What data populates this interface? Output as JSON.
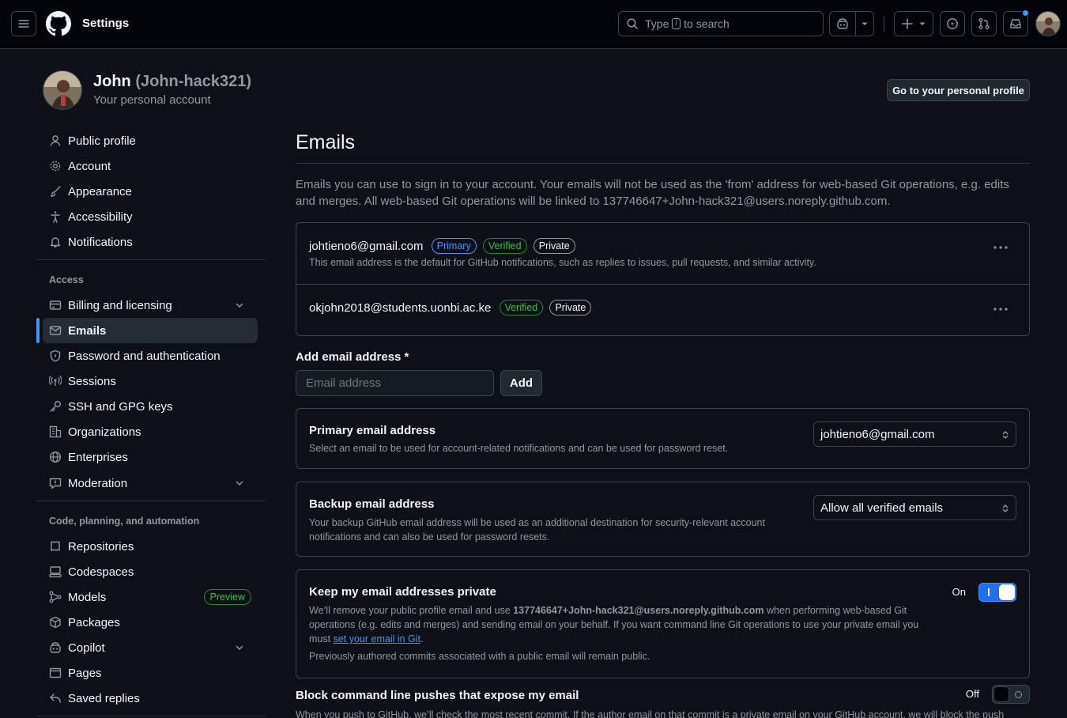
{
  "header": {
    "title": "Settings",
    "search_prefix": "Type",
    "search_key": "/",
    "search_suffix": "to search"
  },
  "profile": {
    "name": "John",
    "handle": "(John-hack321)",
    "subtitle": "Your personal account",
    "go_profile_label": "Go to your personal profile"
  },
  "sidebar": {
    "items_top": [
      "Public profile",
      "Account",
      "Appearance",
      "Accessibility",
      "Notifications"
    ],
    "access_title": "Access",
    "access_items": [
      "Billing and licensing",
      "Emails",
      "Password and authentication",
      "Sessions",
      "SSH and GPG keys",
      "Organizations",
      "Enterprises",
      "Moderation"
    ],
    "code_title": "Code, planning, and automation",
    "code_items": [
      "Repositories",
      "Codespaces",
      "Models",
      "Packages",
      "Copilot",
      "Pages",
      "Saved replies"
    ],
    "preview_badge": "Preview"
  },
  "main": {
    "title": "Emails",
    "intro": "Emails you can use to sign in to your account. Your emails will not be used as the 'from' address for web-based Git operations, e.g. edits and merges. All web-based Git operations will be linked to 137746647+John-hack321@users.noreply.github.com.",
    "emails": [
      {
        "address": "johtieno6@gmail.com",
        "labels": [
          "Primary",
          "Verified",
          "Private"
        ],
        "note": "This email address is the default for GitHub notifications, such as replies to issues, pull requests, and similar activity."
      },
      {
        "address": "okjohn2018@students.uonbi.ac.ke",
        "labels": [
          "Verified",
          "Private"
        ],
        "note": ""
      }
    ],
    "add_email": {
      "label": "Add email address *",
      "placeholder": "Email address",
      "button": "Add"
    },
    "primary": {
      "title": "Primary email address",
      "desc": "Select an email to be used for account-related notifications and can be used for password reset.",
      "value": "johtieno6@gmail.com"
    },
    "backup": {
      "title": "Backup email address",
      "desc": "Your backup GitHub email address will be used as an additional destination for security-relevant account notifications and can also be used for password resets.",
      "value": "Allow all verified emails"
    },
    "keep_private": {
      "title": "Keep my email addresses private",
      "desc_1": "We’ll remove your public profile email and use",
      "desc_email": "137746647+John-hack321@users.noreply.github.com",
      "desc_2": "when performing web-based Git operations (e.g. edits and merges) and sending email on your behalf. If you want command line Git operations to use your private email you must",
      "desc_link": "set your email in Git",
      "desc_3": ".",
      "note": "Previously authored commits associated with a public email will remain public.",
      "state_label": "On"
    },
    "block_push": {
      "title": "Block command line pushes that expose my email",
      "desc": "When you push to GitHub, we’ll check the most recent commit. If the author email on that commit is a private email on your GitHub account, we will block the push",
      "state_label": "Off"
    }
  },
  "colors": {
    "accent": "#4493f8",
    "success": "#3fb950",
    "bg": "#0d1117",
    "header_bg": "#010409",
    "notification_dot": "#4493f8"
  }
}
